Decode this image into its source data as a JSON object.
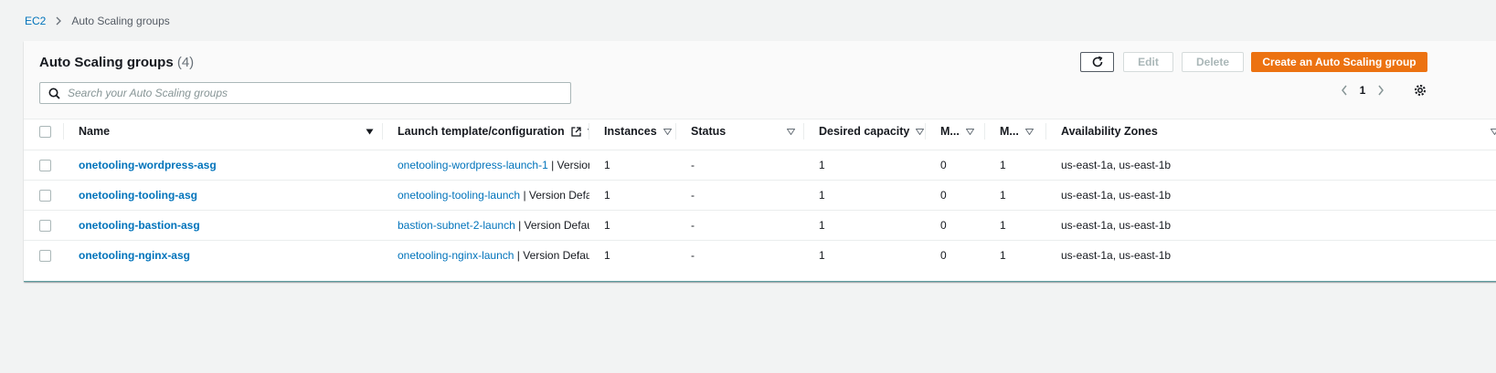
{
  "breadcrumb": {
    "parent": "EC2",
    "current": "Auto Scaling groups"
  },
  "panel": {
    "title": "Auto Scaling groups",
    "count": "(4)",
    "search_placeholder": "Search your Auto Scaling groups",
    "search_value": "",
    "buttons": {
      "edit": "Edit",
      "delete": "Delete",
      "create": "Create an Auto Scaling group"
    },
    "page_number": "1"
  },
  "table": {
    "columns": {
      "name": "Name",
      "launch": "Launch template/configuration",
      "instances": "Instances",
      "status": "Status",
      "desired": "Desired capacity",
      "min": "M...",
      "max": "M...",
      "az": "Availability Zones"
    },
    "rows": [
      {
        "name": "onetooling-wordpress-asg",
        "launch_link": "onetooling-wordpress-launch-1",
        "launch_suffix": " | Version",
        "instances": "1",
        "status": "-",
        "desired": "1",
        "min": "0",
        "max": "1",
        "az": "us-east-1a, us-east-1b"
      },
      {
        "name": "onetooling-tooling-asg",
        "launch_link": "onetooling-tooling-launch",
        "launch_suffix": " | Version Defau",
        "instances": "1",
        "status": "-",
        "desired": "1",
        "min": "0",
        "max": "1",
        "az": "us-east-1a, us-east-1b"
      },
      {
        "name": "onetooling-bastion-asg",
        "launch_link": "bastion-subnet-2-launch",
        "launch_suffix": " | Version Default",
        "instances": "1",
        "status": "-",
        "desired": "1",
        "min": "0",
        "max": "1",
        "az": "us-east-1a, us-east-1b"
      },
      {
        "name": "onetooling-nginx-asg",
        "launch_link": "onetooling-nginx-launch",
        "launch_suffix": " | Version Default",
        "instances": "1",
        "status": "-",
        "desired": "1",
        "min": "0",
        "max": "1",
        "az": "us-east-1a, us-east-1b"
      }
    ]
  },
  "icons": {
    "refresh": "refresh-icon",
    "search": "search-icon",
    "external": "external-link-icon",
    "sort": "sort-caret-icon",
    "settings": "gear-icon"
  },
  "colors": {
    "primary": "#ec7211",
    "link": "#0073bb"
  }
}
